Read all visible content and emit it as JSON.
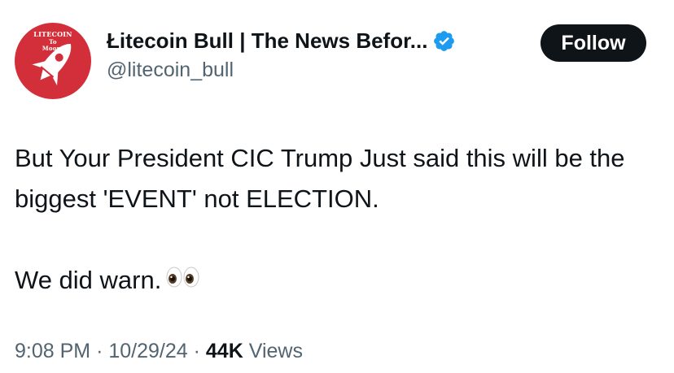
{
  "author": {
    "avatar_lines": [
      "LITECOIN",
      "To",
      "Moon!"
    ],
    "display_name": "Łitecoin Bull | The News Befor...",
    "handle": "@litecoin_bull",
    "verified_icon": "verified-badge-icon",
    "verified_color": "#1d9bf0"
  },
  "follow_button": {
    "label": "Follow"
  },
  "tweet": {
    "line1": "But Your President CIC Trump Just said this will be the biggest 'EVENT' not ELECTION.",
    "line2": "We did warn.",
    "emoji_icon": "eyes-icon"
  },
  "meta": {
    "time": "9:08 PM",
    "separator": "·",
    "date": "10/29/24",
    "views_count": "44K",
    "views_label": "Views"
  },
  "colors": {
    "avatar_bg": "#d32f3a",
    "text_primary": "#0f1419",
    "text_secondary": "#536471",
    "follow_bg": "#0f1419"
  }
}
